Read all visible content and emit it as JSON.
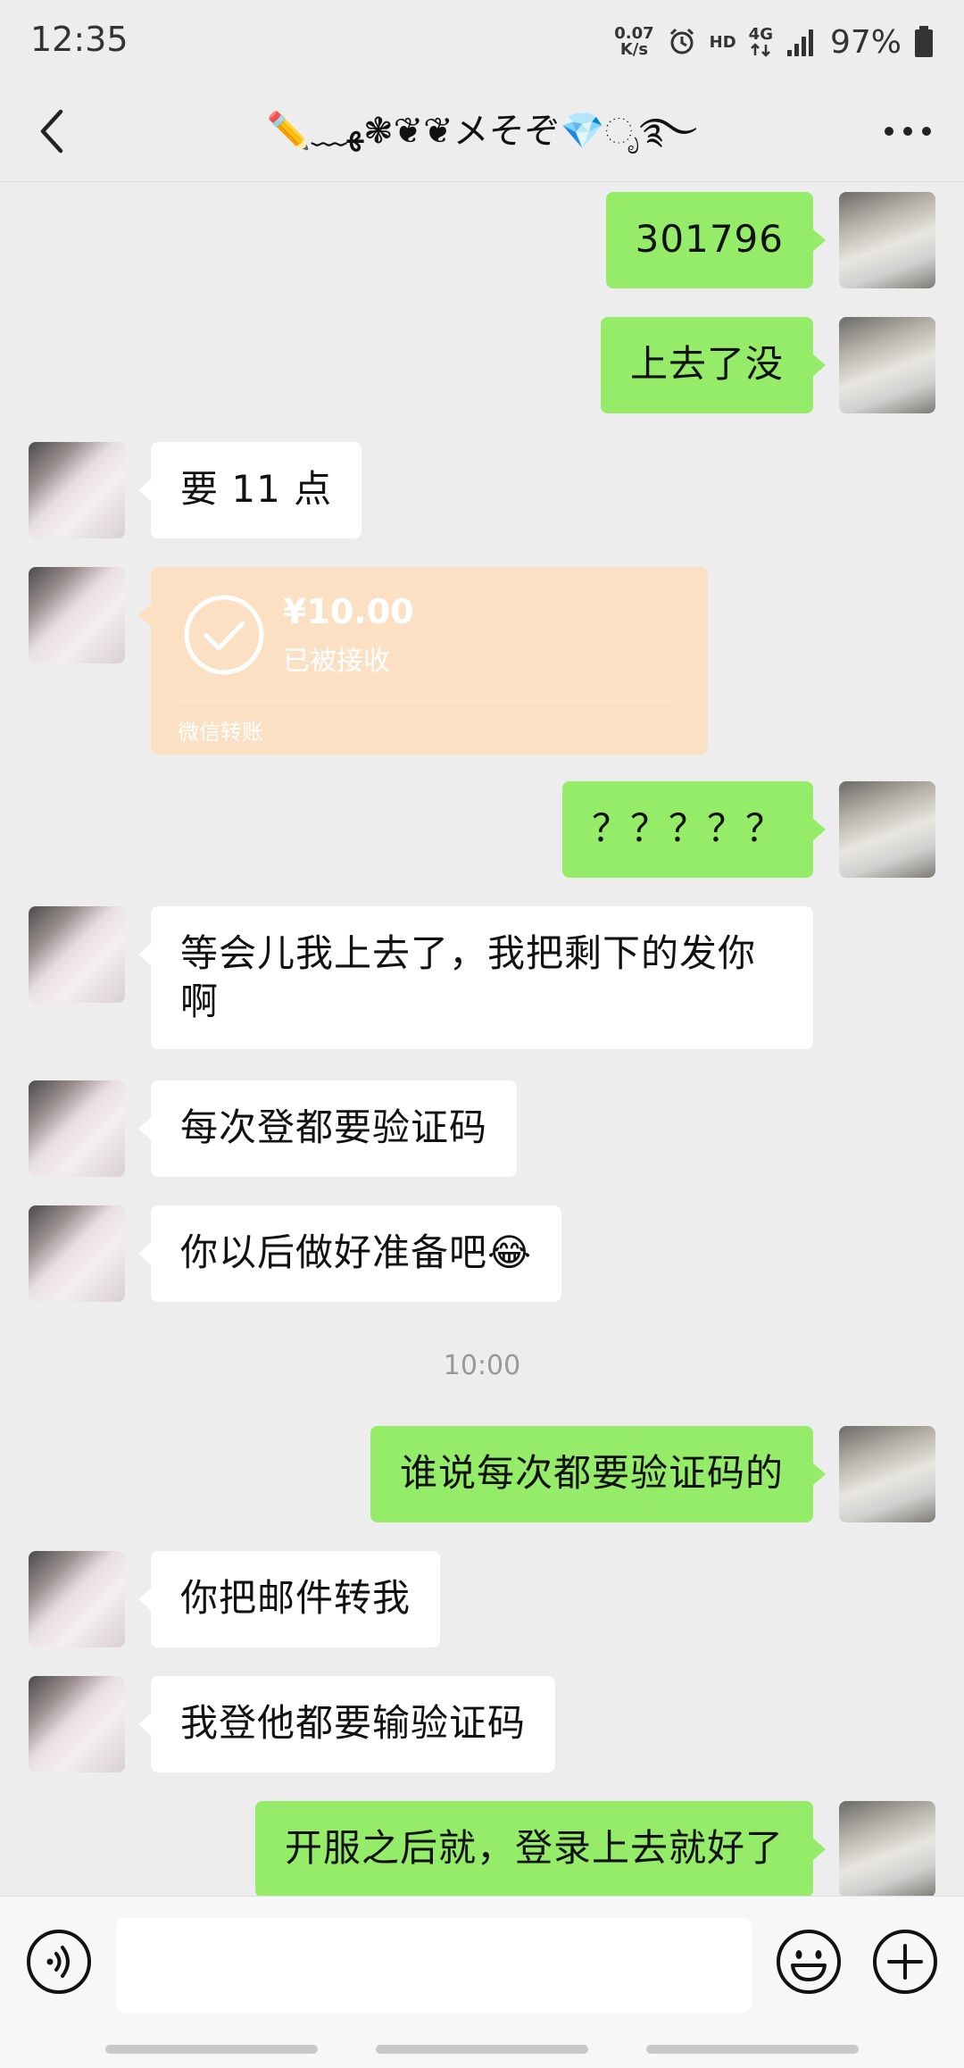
{
  "status_bar": {
    "time": "12:35",
    "net_speed_value": "0.07",
    "net_speed_unit": "K/s",
    "hd_label": "HD",
    "network_label": "4G",
    "battery_percent": "97%"
  },
  "header": {
    "title": "✏️﹏ﻬ❃❦❦メそぞ💎ೃ࿐"
  },
  "messages": [
    {
      "side": "right",
      "text": "301796"
    },
    {
      "side": "right",
      "text": "上去了没"
    },
    {
      "side": "left",
      "text": "要 11 点"
    },
    {
      "side": "left",
      "type": "transfer",
      "amount": "¥10.00",
      "status": "已被接收",
      "footer": "微信转账"
    },
    {
      "side": "right",
      "text": "？？？？？"
    },
    {
      "side": "left",
      "text": "等会儿我上去了，我把剩下的发你啊"
    },
    {
      "side": "left",
      "text": "每次登都要验证码"
    },
    {
      "side": "left",
      "text": "你以后做好准备吧😂"
    },
    {
      "type": "time",
      "text": "10:00"
    },
    {
      "side": "right",
      "text": "谁说每次都要验证码的"
    },
    {
      "side": "left",
      "text": "你把邮件转我"
    },
    {
      "side": "left",
      "text": "我登他都要输验证码"
    },
    {
      "side": "right",
      "text": "开服之后就，登录上去就好了"
    }
  ],
  "input_bar": {
    "placeholder": ""
  },
  "icons": {
    "back": "chevron-left-icon",
    "more": "more-dots-icon",
    "voice": "voice-icon",
    "emoji": "emoji-icon",
    "plus": "plus-icon",
    "transfer_check": "check-circle-icon"
  },
  "colors": {
    "self_bubble": "#95ec69",
    "other_bubble": "#ffffff",
    "transfer_bubble": "#fce0c3",
    "background": "#ededed"
  }
}
